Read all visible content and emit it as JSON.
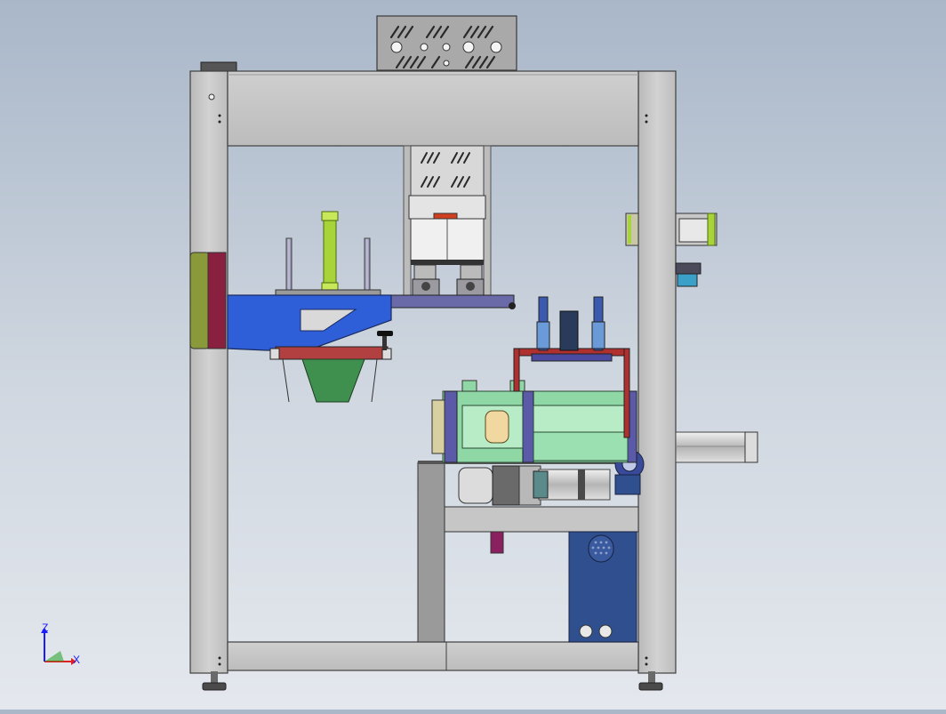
{
  "window": {
    "title": ""
  },
  "viewport": {
    "background_top": "#a9b7c9",
    "background_bottom": "#e4e8ee"
  },
  "colors": {
    "frame": "#c8c8c8",
    "frame_edge": "#4a4a4a",
    "blue_arm": "#2f5fd8",
    "green_housing": "#8fd8a6",
    "navy_panel": "#2f4f8f",
    "lime_cylinder": "#a8d43a",
    "olive_pad": "#8a9a3a",
    "maroon_pad": "#8a2040",
    "red_frame": "#b03030",
    "purple_plate": "#4a4aa0",
    "green_hopper": "#3f8f4f",
    "axis_x": "#e02020",
    "axis_y": "#20a020",
    "axis_z": "#1a1aff"
  },
  "triad": {
    "z_label": "Z",
    "x_label": "X",
    "icon": "coordinate-axes-icon"
  }
}
